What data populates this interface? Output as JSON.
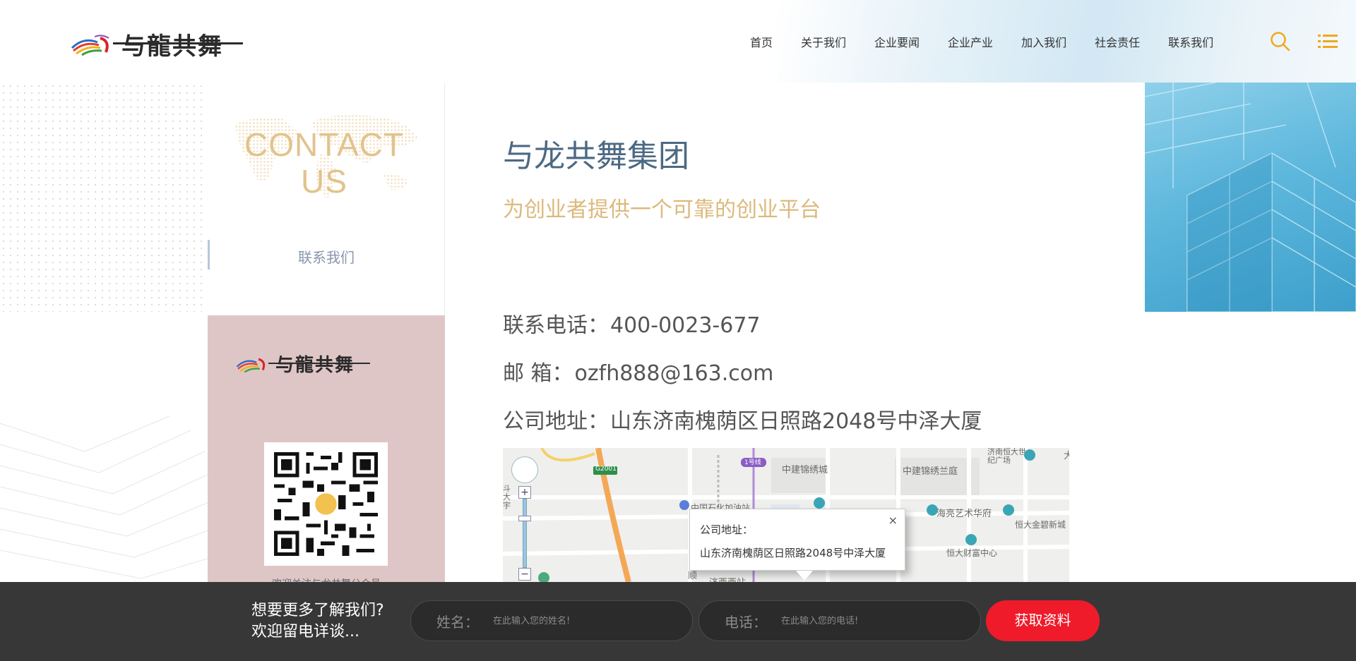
{
  "header": {
    "logo_text": "与龍共舞",
    "nav": [
      "首页",
      "关于我们",
      "企业要闻",
      "企业产业",
      "加入我们",
      "社会责任",
      "联系我们"
    ],
    "icons": {
      "search": "search-icon",
      "menu": "list-menu-icon"
    },
    "accent_color": "#f0a81c"
  },
  "sidebar": {
    "title_line1": "CONTACT",
    "title_line2": "US",
    "active_link": "联系我们",
    "brand_logo_text": "与龍共舞",
    "qr_caption": "欢迎关注与龙共舞公众号"
  },
  "main": {
    "company_title": "与龙共舞集团",
    "slogan": "为创业者提供一个可靠的创业平台",
    "phone_label": "联系电话：",
    "phone": "400-0023-677",
    "email_label": "邮 箱：",
    "email": "ozfh888@163.com",
    "address_label": "公司地址：",
    "address": "山东济南槐荫区日照路2048号中泽大厦"
  },
  "map": {
    "labels": {
      "road_g2001": "G2001",
      "metro_1": "1号线",
      "place_1": "中建锦绣城",
      "place_2": "中建锦绣兰庭",
      "place_3": "济南恒大世纪广场",
      "place_4": "海亮艺术华府",
      "place_5": "恒大金碧新城",
      "place_6": "恒大财富中心",
      "place_7": "中国石化加油站",
      "place_8": "斗大宇",
      "place_9": "顺",
      "place_10": "济西西站",
      "place_11": "大"
    },
    "popup_title": "公司地址：",
    "popup_address": "山东济南槐荫区日照路2048号中泽大厦",
    "close_symbol": "×",
    "zoom_in": "+",
    "zoom_out": "−"
  },
  "bottom_bar": {
    "cta_line1": "想要更多了解我们?",
    "cta_line2": "欢迎留电详谈...",
    "name_label": "姓名：",
    "name_placeholder": "在此输入您的姓名!",
    "phone_label": "电话：",
    "phone_placeholder": "在此输入您的电话!",
    "submit_label": "获取资料",
    "submit_color": "#ef1b2a"
  }
}
